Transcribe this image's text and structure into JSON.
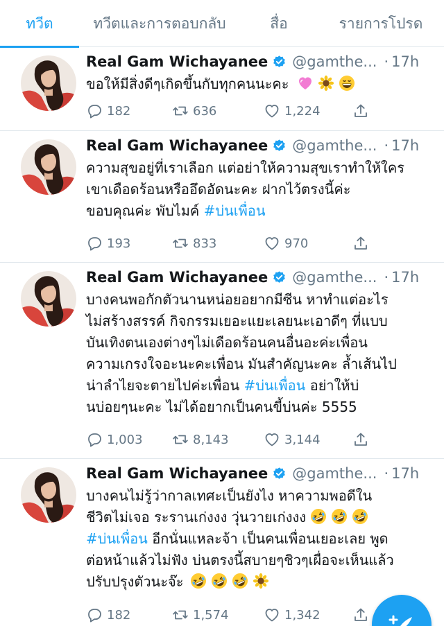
{
  "tabs": [
    {
      "label": "ทวีต",
      "active": true
    },
    {
      "label": "ทวีตและการตอบกลับ",
      "active": false
    },
    {
      "label": "สื่อ",
      "active": false
    },
    {
      "label": "รายการโปรด",
      "active": false
    }
  ],
  "tweets": [
    {
      "name": "Real Gam Wichayanee",
      "handle": "@gamthe...",
      "dot": "·",
      "time": "17h",
      "lines": [
        "ขอให้มีสิ่งดีๆเกิดขึ้นกับทุกคนนะคะ"
      ],
      "hashtag": "",
      "emoji": [
        "heart-emoji",
        "sunflower-emoji",
        "grin-emoji"
      ],
      "replies": "182",
      "retweets": "636",
      "likes": "1,224"
    },
    {
      "name": "Real Gam Wichayanee",
      "handle": "@gamthe...",
      "dot": "·",
      "time": "17h",
      "lines": [
        "ความสุขอยู่ที่เราเลือก แต่อย่าให้ความสุขเราทำให้ใคร",
        "เขาเดือดร้อนหรืออึดอัดนะคะ ฝากไว้ตรงนี้ค่ะ",
        "ขอบคุณค่ะ พับไมค์"
      ],
      "hashtag": "#บ่นเพื่อน",
      "emoji": [],
      "replies": "193",
      "retweets": "833",
      "likes": "970"
    },
    {
      "name": "Real Gam Wichayanee",
      "handle": "@gamthe...",
      "dot": "·",
      "time": "17h",
      "lines": [
        "บางคนพอกักตัวนานหน่อยอยากมีซีน หาทำแต่อะไร",
        "ไม่สร้างสรรค์ กิจกรรมเยอะแยะเลยนะเอาดีๆ ที่แบบ",
        "บันเทิงตนเองต่างๆไม่เดือดร้อนคนอื่นอะค่ะเพื่อน",
        "ความเกรงใจอะนะคะเพื่อน มันสำคัญนะคะ ล้ำเส้นไป",
        "น่าลำไยจะตายไปค่ะเพื่อน",
        "อย่าให้บ่",
        "นบ่อยๆนะคะ ไม่ได้อยากเป็นคนขี้บ่นค่ะ 5555"
      ],
      "hashtag": "#บ่นเพื่อน",
      "emoji": [],
      "replies": "1,003",
      "retweets": "8,143",
      "likes": "3,144"
    },
    {
      "name": "Real Gam Wichayanee",
      "handle": "@gamthe...",
      "dot": "·",
      "time": "17h",
      "lines": [
        "บางคนไม่รู้ว่ากาลเทศะเป็นยังไง หาความพอดีใน",
        "ชีวิตไม่เจอ ระรานเก่งงง วุ่นวายเก่งงง",
        "อีกนั่นแหละจ้า เป็นคนเพื่อนเยอะเลย พูด",
        "ต่อหน้าแล้วไม่ฟัง บ่นตรงนี้สบายๆชิวๆเผื่อจะเห็นแล้ว",
        "ปรับปรุงตัวนะจ๊ะ"
      ],
      "hashtag": "#บ่นเพื่อน",
      "emoji": [
        "rofl-emoji",
        "sunflower-emoji"
      ],
      "replies": "182",
      "retweets": "1,574",
      "likes": "1,342"
    }
  ],
  "colors": {
    "accent": "#1da1f2",
    "muted": "#657786",
    "text": "#14171a",
    "divider": "#e1e8ed"
  },
  "icons": {
    "reply": "reply-icon",
    "retweet": "retweet-icon",
    "like": "like-icon",
    "share": "share-icon",
    "verified": "verified-badge-icon",
    "compose": "compose-tweet-icon"
  }
}
